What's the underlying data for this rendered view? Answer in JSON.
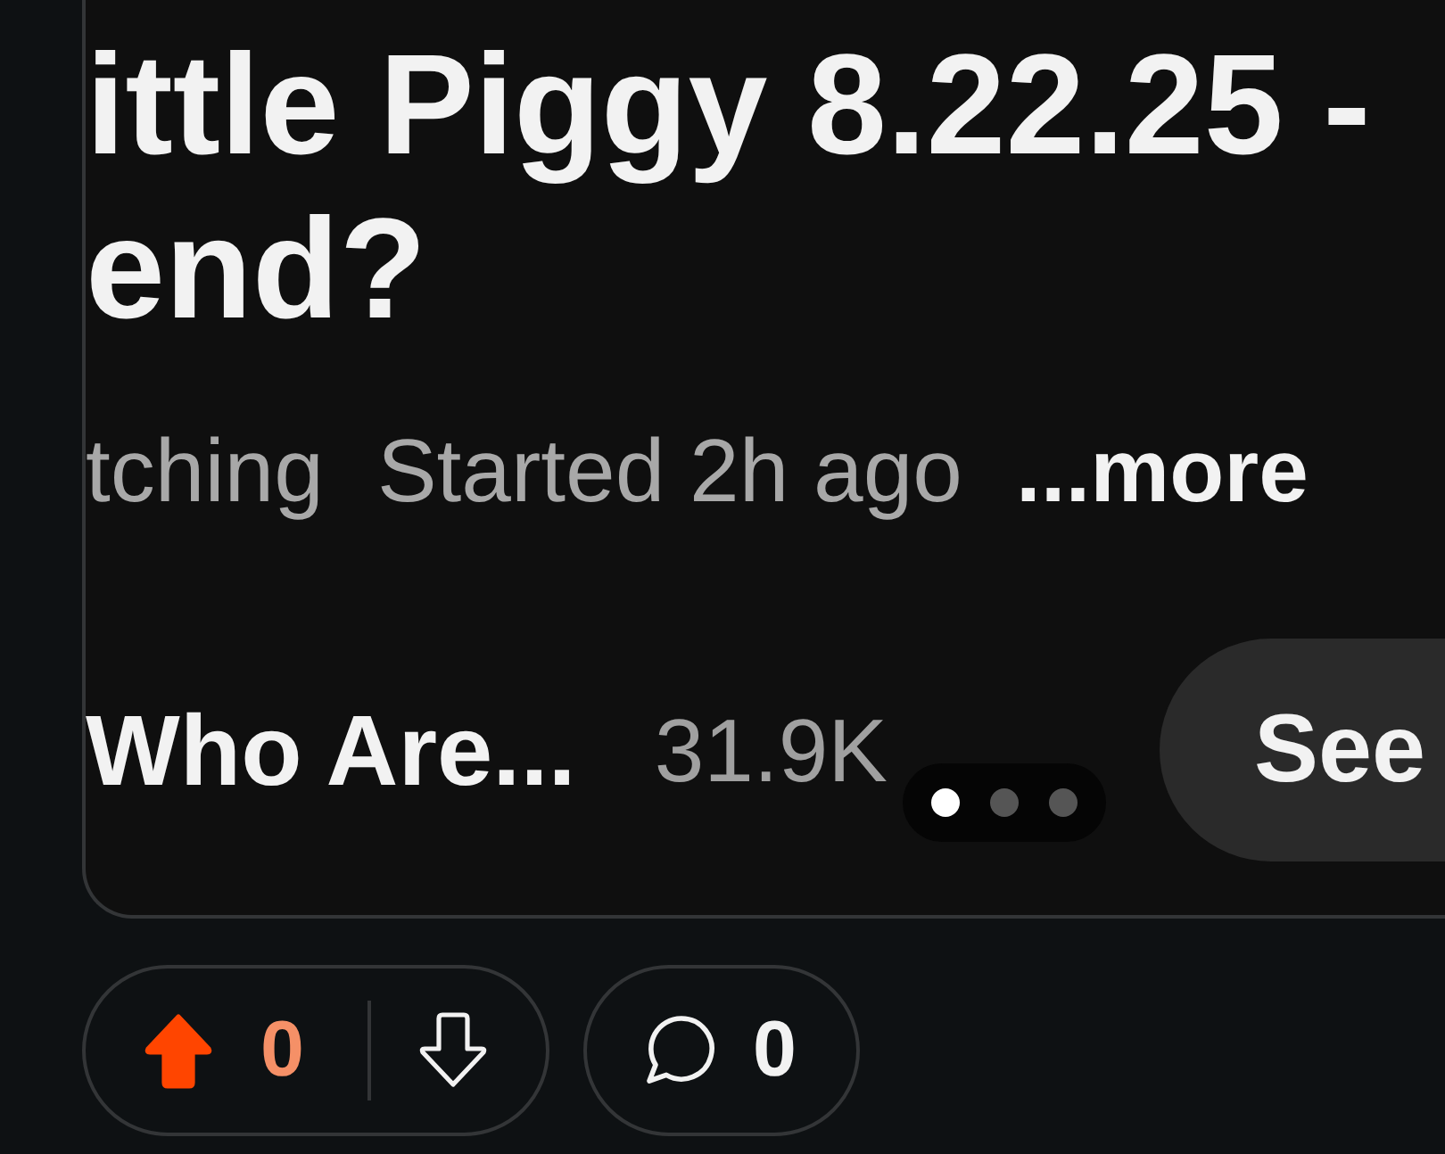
{
  "post": {
    "title_lines": [
      "ittle Piggy 8.22.25 -",
      "end?"
    ],
    "meta": [
      "tching",
      "Started 2h ago"
    ],
    "more_link": "...more"
  },
  "community": {
    "name": "Who Are...",
    "members": "31.9K",
    "button": "See"
  },
  "carousel": {
    "dots": [
      {
        "selected": true
      },
      {
        "selected": false
      },
      {
        "selected": false
      }
    ]
  },
  "actions": {
    "vote": {
      "upvoted": true,
      "downvoted": false,
      "score": "0"
    },
    "comments": "0"
  }
}
